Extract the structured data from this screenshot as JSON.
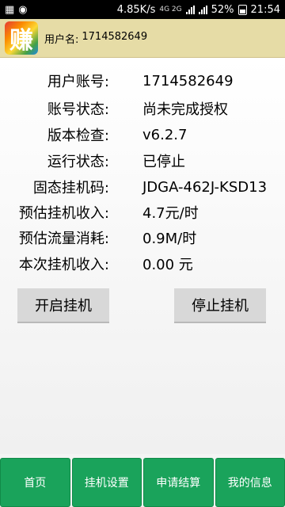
{
  "status_bar": {
    "speed": "4.85K/s",
    "network_labels": "4G 2G",
    "battery": "52%",
    "time": "21:54"
  },
  "header": {
    "app_icon_text": "赚",
    "user_label": "用户名:",
    "user_value": "1714582649"
  },
  "info": [
    {
      "label": "用户账号:",
      "value": "1714582649"
    },
    {
      "label": "账号状态:",
      "value": "尚未完成授权"
    },
    {
      "label": "版本检查:",
      "value": "v6.2.7"
    },
    {
      "label": "运行状态:",
      "value": "已停止"
    },
    {
      "label": "固态挂机码:",
      "value": "JDGA-462J-KSD13"
    },
    {
      "label": "预估挂机收入:",
      "value": "4.7元/时"
    },
    {
      "label": "预估流量消耗:",
      "value": "0.9M/时"
    },
    {
      "label": "本次挂机收入:",
      "value": "0.00 元"
    }
  ],
  "buttons": {
    "start": "开启挂机",
    "stop": "停止挂机"
  },
  "nav": [
    {
      "label": "首页"
    },
    {
      "label": "挂机设置"
    },
    {
      "label": "申请结算"
    },
    {
      "label": "我的信息"
    }
  ],
  "colors": {
    "header_bg": "#e6dca6",
    "nav_green": "#1aa35b",
    "button_gray": "#d8d8d8"
  }
}
